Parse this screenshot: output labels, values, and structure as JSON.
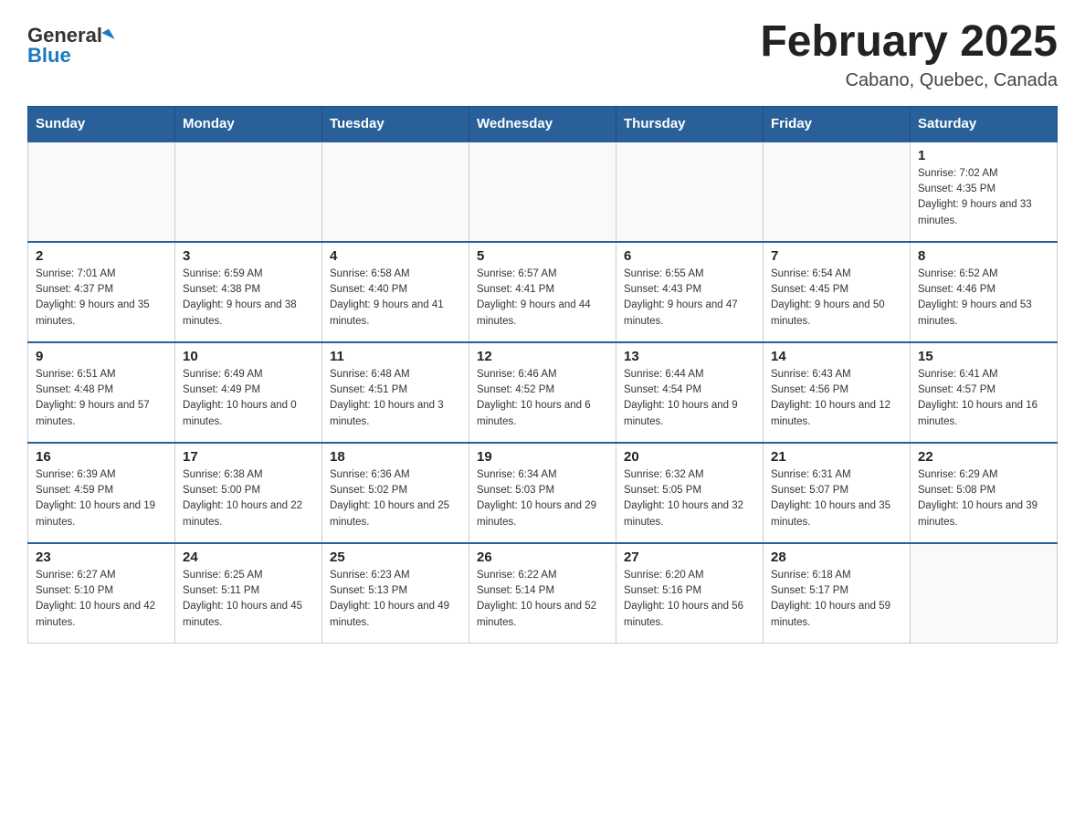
{
  "header": {
    "logo_general": "General",
    "logo_blue": "Blue",
    "title": "February 2025",
    "subtitle": "Cabano, Quebec, Canada"
  },
  "days_of_week": [
    "Sunday",
    "Monday",
    "Tuesday",
    "Wednesday",
    "Thursday",
    "Friday",
    "Saturday"
  ],
  "weeks": [
    [
      {
        "day": "",
        "info": ""
      },
      {
        "day": "",
        "info": ""
      },
      {
        "day": "",
        "info": ""
      },
      {
        "day": "",
        "info": ""
      },
      {
        "day": "",
        "info": ""
      },
      {
        "day": "",
        "info": ""
      },
      {
        "day": "1",
        "info": "Sunrise: 7:02 AM\nSunset: 4:35 PM\nDaylight: 9 hours and 33 minutes."
      }
    ],
    [
      {
        "day": "2",
        "info": "Sunrise: 7:01 AM\nSunset: 4:37 PM\nDaylight: 9 hours and 35 minutes."
      },
      {
        "day": "3",
        "info": "Sunrise: 6:59 AM\nSunset: 4:38 PM\nDaylight: 9 hours and 38 minutes."
      },
      {
        "day": "4",
        "info": "Sunrise: 6:58 AM\nSunset: 4:40 PM\nDaylight: 9 hours and 41 minutes."
      },
      {
        "day": "5",
        "info": "Sunrise: 6:57 AM\nSunset: 4:41 PM\nDaylight: 9 hours and 44 minutes."
      },
      {
        "day": "6",
        "info": "Sunrise: 6:55 AM\nSunset: 4:43 PM\nDaylight: 9 hours and 47 minutes."
      },
      {
        "day": "7",
        "info": "Sunrise: 6:54 AM\nSunset: 4:45 PM\nDaylight: 9 hours and 50 minutes."
      },
      {
        "day": "8",
        "info": "Sunrise: 6:52 AM\nSunset: 4:46 PM\nDaylight: 9 hours and 53 minutes."
      }
    ],
    [
      {
        "day": "9",
        "info": "Sunrise: 6:51 AM\nSunset: 4:48 PM\nDaylight: 9 hours and 57 minutes."
      },
      {
        "day": "10",
        "info": "Sunrise: 6:49 AM\nSunset: 4:49 PM\nDaylight: 10 hours and 0 minutes."
      },
      {
        "day": "11",
        "info": "Sunrise: 6:48 AM\nSunset: 4:51 PM\nDaylight: 10 hours and 3 minutes."
      },
      {
        "day": "12",
        "info": "Sunrise: 6:46 AM\nSunset: 4:52 PM\nDaylight: 10 hours and 6 minutes."
      },
      {
        "day": "13",
        "info": "Sunrise: 6:44 AM\nSunset: 4:54 PM\nDaylight: 10 hours and 9 minutes."
      },
      {
        "day": "14",
        "info": "Sunrise: 6:43 AM\nSunset: 4:56 PM\nDaylight: 10 hours and 12 minutes."
      },
      {
        "day": "15",
        "info": "Sunrise: 6:41 AM\nSunset: 4:57 PM\nDaylight: 10 hours and 16 minutes."
      }
    ],
    [
      {
        "day": "16",
        "info": "Sunrise: 6:39 AM\nSunset: 4:59 PM\nDaylight: 10 hours and 19 minutes."
      },
      {
        "day": "17",
        "info": "Sunrise: 6:38 AM\nSunset: 5:00 PM\nDaylight: 10 hours and 22 minutes."
      },
      {
        "day": "18",
        "info": "Sunrise: 6:36 AM\nSunset: 5:02 PM\nDaylight: 10 hours and 25 minutes."
      },
      {
        "day": "19",
        "info": "Sunrise: 6:34 AM\nSunset: 5:03 PM\nDaylight: 10 hours and 29 minutes."
      },
      {
        "day": "20",
        "info": "Sunrise: 6:32 AM\nSunset: 5:05 PM\nDaylight: 10 hours and 32 minutes."
      },
      {
        "day": "21",
        "info": "Sunrise: 6:31 AM\nSunset: 5:07 PM\nDaylight: 10 hours and 35 minutes."
      },
      {
        "day": "22",
        "info": "Sunrise: 6:29 AM\nSunset: 5:08 PM\nDaylight: 10 hours and 39 minutes."
      }
    ],
    [
      {
        "day": "23",
        "info": "Sunrise: 6:27 AM\nSunset: 5:10 PM\nDaylight: 10 hours and 42 minutes."
      },
      {
        "day": "24",
        "info": "Sunrise: 6:25 AM\nSunset: 5:11 PM\nDaylight: 10 hours and 45 minutes."
      },
      {
        "day": "25",
        "info": "Sunrise: 6:23 AM\nSunset: 5:13 PM\nDaylight: 10 hours and 49 minutes."
      },
      {
        "day": "26",
        "info": "Sunrise: 6:22 AM\nSunset: 5:14 PM\nDaylight: 10 hours and 52 minutes."
      },
      {
        "day": "27",
        "info": "Sunrise: 6:20 AM\nSunset: 5:16 PM\nDaylight: 10 hours and 56 minutes."
      },
      {
        "day": "28",
        "info": "Sunrise: 6:18 AM\nSunset: 5:17 PM\nDaylight: 10 hours and 59 minutes."
      },
      {
        "day": "",
        "info": ""
      }
    ]
  ]
}
